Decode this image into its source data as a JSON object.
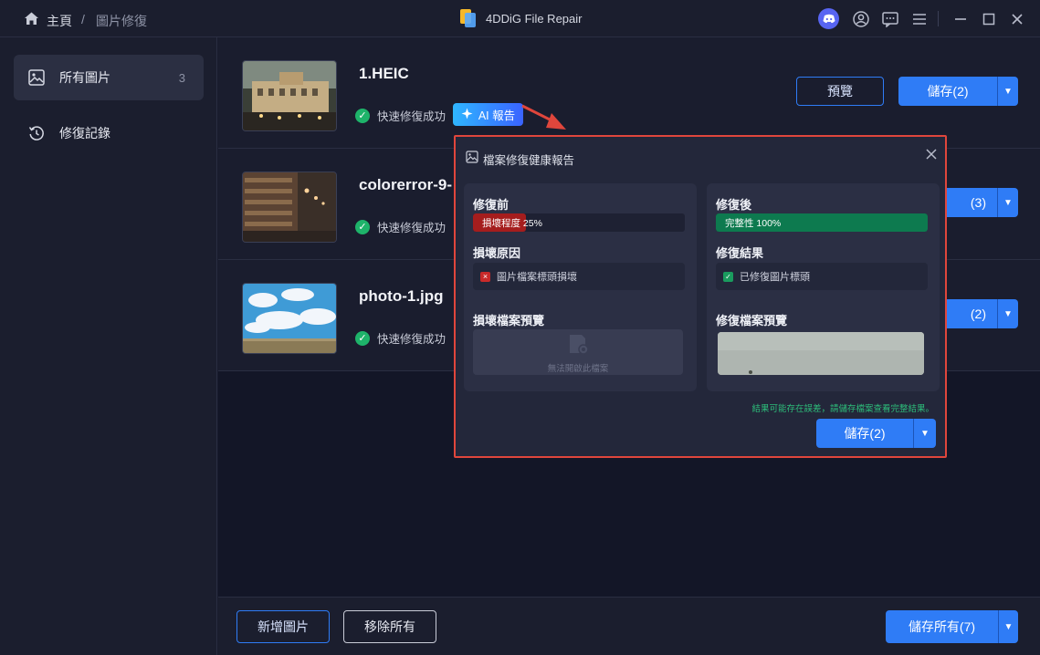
{
  "titlebar": {
    "home_label": "主頁",
    "separator": "/",
    "current_page": "圖片修復",
    "app_title": "4DDiG File Repair"
  },
  "sidebar": {
    "items": [
      {
        "label": "所有圖片",
        "count": "3"
      },
      {
        "label": "修復記錄"
      }
    ]
  },
  "files": [
    {
      "name": "1.HEIC",
      "status": "快速修復成功",
      "ai_label": "AI 報告",
      "preview_label": "預覽",
      "save_label": "儲存(2)"
    },
    {
      "name": "colorerror-9-",
      "status": "快速修復成功",
      "save_label": "(3)"
    },
    {
      "name": "photo-1.jpg",
      "status": "快速修復成功",
      "save_label": "(2)"
    }
  ],
  "bottom": {
    "add_label": "新增圖片",
    "remove_label": "移除所有",
    "save_all_label": "儲存所有(7)"
  },
  "report": {
    "title": "檔案修復健康報告",
    "before": {
      "heading": "修復前",
      "bar_label": "損壞程度 25%",
      "bar_value": 0.25,
      "reason_heading": "損壞原因",
      "reason": "圖片檔案標頭損壞",
      "preview_heading": "損壞檔案預覽",
      "preview_text": "無法開啟此檔案"
    },
    "after": {
      "heading": "修復後",
      "bar_label": "完整性 100%",
      "bar_value": 1.0,
      "result_heading": "修復結果",
      "result": "已修復圖片標頭",
      "preview_heading": "修復檔案預覽"
    },
    "note": "結果可能存在誤差，請儲存檔案查看完整結果。",
    "save_label": "儲存(2)"
  },
  "colors": {
    "accent": "#2f7cf6",
    "success": "#1eb36a",
    "danger": "#e0463c",
    "damage_bar": "#a51d1d",
    "integrity_bar": "#0d7a4f"
  }
}
